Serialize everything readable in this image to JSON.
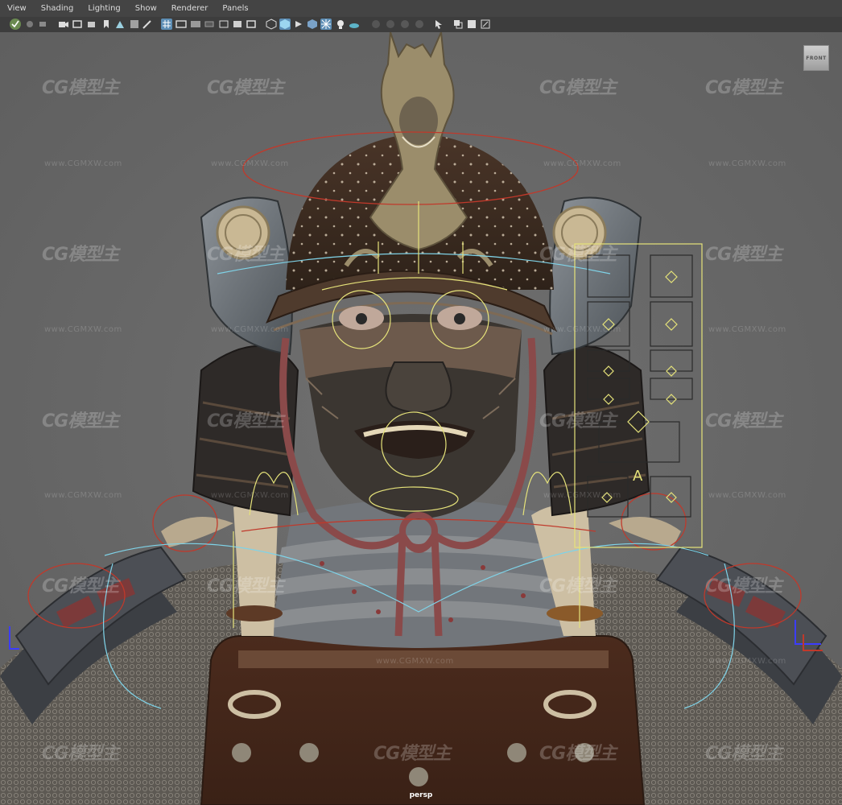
{
  "menubar": {
    "items": [
      "View",
      "Shading",
      "Lighting",
      "Show",
      "Renderer",
      "Panels"
    ]
  },
  "toolbar": {
    "icons": [
      "select-camera-icon",
      "camera-attributes-icon",
      "bookmark-icon",
      "image-plane-icon",
      "grid-icon",
      "film-gate-icon",
      "resolution-gate-icon",
      "safe-title-icon",
      "wireframe-icon",
      "smooth-shade-icon",
      "textured-icon",
      "lights-icon",
      "shadows-icon",
      "xray-icon",
      "isolate-select-icon",
      "hud-icon"
    ]
  },
  "viewport": {
    "camera_label": "persp",
    "viewcube_label": "FRONT",
    "rig_label": "A",
    "watermark_logo": "CG模型主",
    "watermark_url": "www.CGMXW.com"
  },
  "colors": {
    "background": "#6a6a6a",
    "rig_yellow": "#e6e37a",
    "rig_red": "#c0392b",
    "rig_cyan": "#7fd3e8",
    "active_tool": "#5d8eb5"
  }
}
